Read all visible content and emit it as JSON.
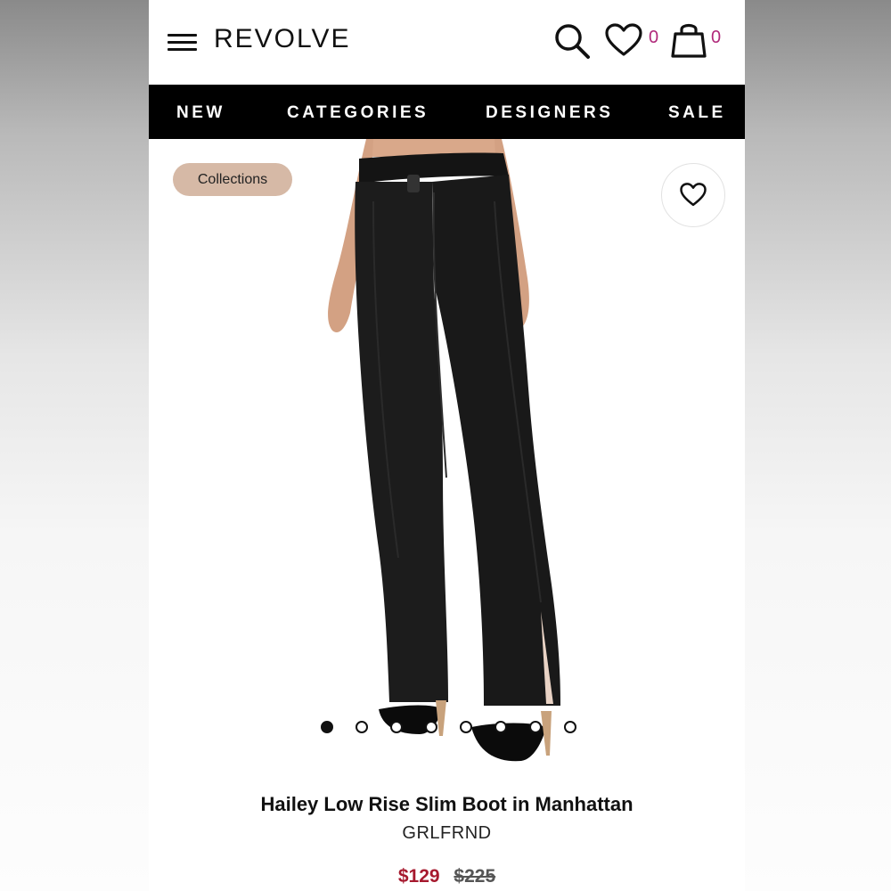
{
  "header": {
    "logo": "REVOLVE",
    "wishlist_count": "0",
    "bag_count": "0",
    "icons": [
      "menu-icon",
      "search-icon",
      "heart-icon",
      "bag-icon"
    ]
  },
  "nav": {
    "items": [
      "NEW",
      "CATEGORIES",
      "DESIGNERS",
      "SALE"
    ]
  },
  "gallery": {
    "badge": "Collections",
    "total_images": 8,
    "active_index": 0
  },
  "product": {
    "title": "Hailey Low Rise Slim Boot in Manhattan",
    "brand": "GRLFRND",
    "sale_price": "$129",
    "original_price": "$225"
  },
  "colors": {
    "nav_bg": "#000000",
    "badge_bg": "#d6b9a6",
    "count_color": "#b0287a",
    "sale_price": "#a6192e"
  }
}
